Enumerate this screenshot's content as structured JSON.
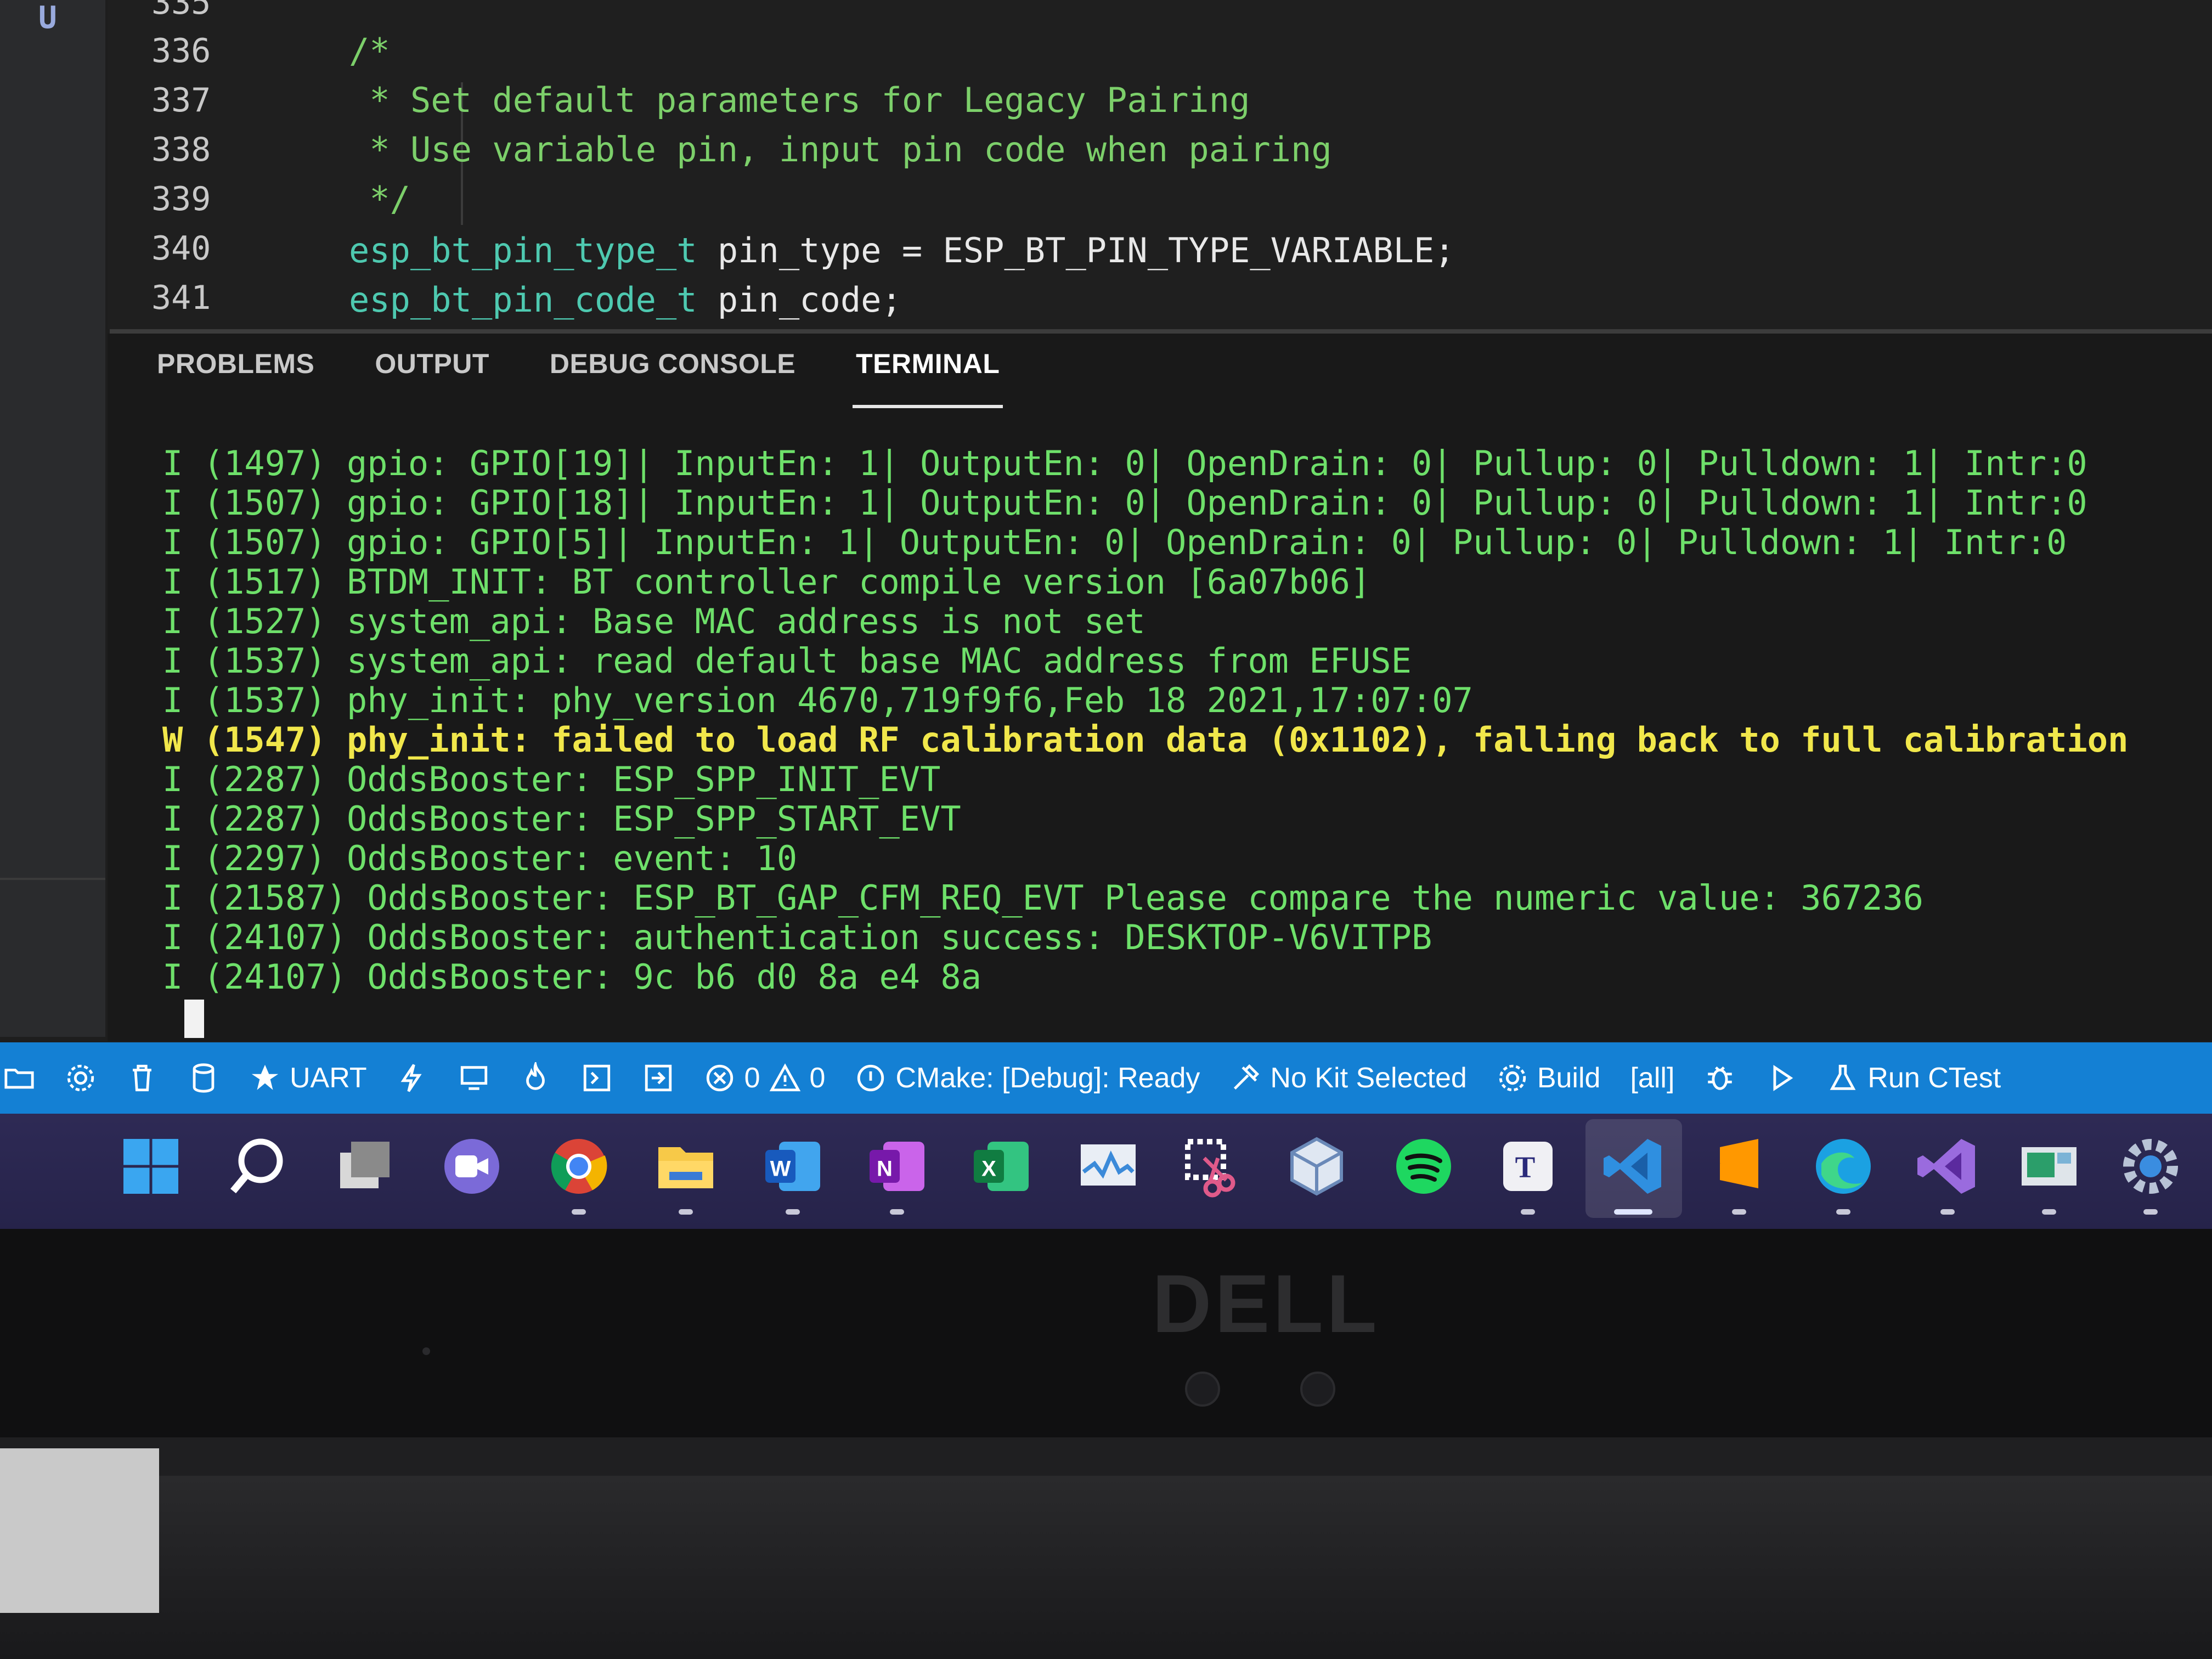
{
  "activity_bar": {
    "badge": "U"
  },
  "editor": {
    "lines": [
      {
        "num": "335",
        "text": ""
      },
      {
        "num": "336",
        "text": "/*",
        "cls": "cmt"
      },
      {
        "num": "337",
        "text": " * Set default parameters for Legacy Pairing",
        "cls": "cmt"
      },
      {
        "num": "338",
        "text": " * Use variable pin, input pin code when pairing",
        "cls": "cmt"
      },
      {
        "num": "339",
        "text": " */",
        "cls": "cmt"
      },
      {
        "num": "340",
        "type": "esp_bt_pin_type_t",
        "rest": " pin_type = ESP_BT_PIN_TYPE_VARIABLE;"
      },
      {
        "num": "341",
        "type": "esp_bt_pin_code_t",
        "rest": " pin_code;"
      }
    ]
  },
  "panel": {
    "tabs": [
      "PROBLEMS",
      "OUTPUT",
      "DEBUG CONSOLE",
      "TERMINAL"
    ],
    "active_tab": "TERMINAL",
    "terminal_lines": [
      {
        "text": "I (1497) gpio: GPIO[19]| InputEn: 1| OutputEn: 0| OpenDrain: 0| Pullup: 0| Pulldown: 1| Intr:0",
        "level": "info"
      },
      {
        "text": "I (1507) gpio: GPIO[18]| InputEn: 1| OutputEn: 0| OpenDrain: 0| Pullup: 0| Pulldown: 1| Intr:0",
        "level": "info"
      },
      {
        "text": "I (1507) gpio: GPIO[5]| InputEn: 1| OutputEn: 0| OpenDrain: 0| Pullup: 0| Pulldown: 1| Intr:0",
        "level": "info"
      },
      {
        "text": "I (1517) BTDM_INIT: BT controller compile version [6a07b06]",
        "level": "info"
      },
      {
        "text": "I (1527) system_api: Base MAC address is not set",
        "level": "info"
      },
      {
        "text": "I (1537) system_api: read default base MAC address from EFUSE",
        "level": "info"
      },
      {
        "text": "I (1537) phy_init: phy_version 4670,719f9f6,Feb 18 2021,17:07:07",
        "level": "info"
      },
      {
        "text": "W (1547) phy_init: failed to load RF calibration data (0x1102), falling back to full calibration",
        "level": "warn"
      },
      {
        "text": "I (2287) OddsBooster: ESP_SPP_INIT_EVT",
        "level": "info"
      },
      {
        "text": "I (2287) OddsBooster: ESP_SPP_START_EVT",
        "level": "info"
      },
      {
        "text": "I (2297) OddsBooster: event: 10",
        "level": "info"
      },
      {
        "text": "I (21587) OddsBooster: ESP_BT_GAP_CFM_REQ_EVT Please compare the numeric value: 367236",
        "level": "info"
      },
      {
        "text": "I (24107) OddsBooster: authentication success: DESKTOP-V6VITPB",
        "level": "info"
      },
      {
        "text": "I (24107) OddsBooster: 9c b6 d0 8a e4 8a",
        "level": "info"
      }
    ]
  },
  "status_bar": {
    "uart": "UART",
    "errors": "0",
    "warnings": "0",
    "cmake": "CMake: [Debug]: Ready",
    "kit": "No Kit Selected",
    "build": "Build",
    "target": "[all]",
    "ctest": "Run CTest"
  },
  "taskbar": {
    "icons": [
      "windows-start",
      "search",
      "task-view",
      "teams-chat",
      "chrome",
      "file-explorer",
      "word",
      "onenote",
      "excel",
      "monitor-app",
      "snipping-tool",
      "virtualbox",
      "spotify",
      "typora",
      "vscode",
      "sublime",
      "edge",
      "visual-studio",
      "terminal-app",
      "settings"
    ]
  },
  "bezel": {
    "brand": "DELL"
  },
  "colors": {
    "status_bar": "#1480d4",
    "terminal_text": "#6ee06a",
    "warning_text": "#f1e74b",
    "comment": "#7ccf6a",
    "type": "#4ec9b0"
  }
}
